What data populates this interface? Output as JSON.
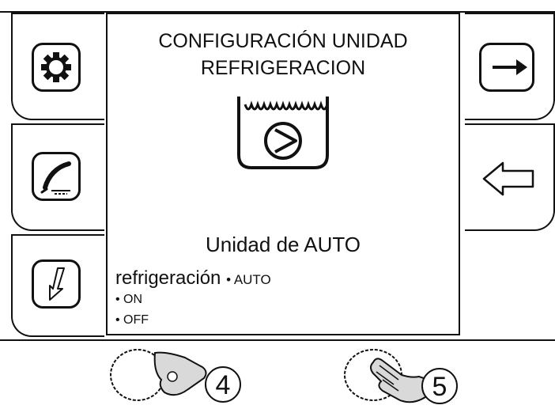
{
  "screen": {
    "title_line1": "CONFIGURACIÓN UNIDAD",
    "title_line2": "REFRIGERACION",
    "icon": "cooling-unit-pump-icon",
    "unit_label": "Unidad de AUTO",
    "setting_name": "refrigeración",
    "current_value": "• AUTO",
    "options": [
      "• ON",
      "• OFF"
    ]
  },
  "left_buttons": [
    {
      "icon": "gear-icon"
    },
    {
      "icon": "welding-torch-icon"
    },
    {
      "icon": "down-arrow-icon"
    }
  ],
  "right_buttons": [
    {
      "icon": "exit-arrow-icon"
    },
    {
      "icon": "back-arrow-icon"
    }
  ],
  "controls": [
    {
      "number": "4",
      "icon": "knob-turn-icon"
    },
    {
      "number": "5",
      "icon": "knob-press-icon"
    }
  ]
}
